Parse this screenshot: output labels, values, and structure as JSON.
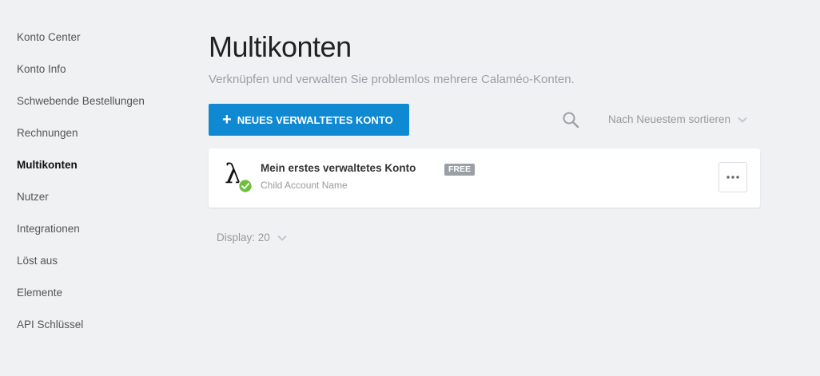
{
  "sidebar": {
    "items": [
      {
        "label": "Konto Center"
      },
      {
        "label": "Konto Info"
      },
      {
        "label": "Schwebende Bestellungen"
      },
      {
        "label": "Rechnungen"
      },
      {
        "label": "Multikonten",
        "active": true
      },
      {
        "label": "Nutzer"
      },
      {
        "label": "Integrationen"
      },
      {
        "label": "Löst aus"
      },
      {
        "label": "Elemente"
      },
      {
        "label": "API Schlüssel"
      }
    ]
  },
  "header": {
    "title": "Multikonten",
    "subtitle": "Verknüpfen und verwalten Sie problemlos mehrere Calaméo-Konten."
  },
  "toolbar": {
    "new_button_label": "NEUES VERWALTETES KONTO",
    "sort_label": "Nach Neuestem sortieren"
  },
  "accounts": [
    {
      "name": "Mein erstes verwaltetes Konto",
      "subtitle": "Child Account Name",
      "plan": "FREE"
    }
  ],
  "pagination": {
    "display_label": "Display: 20"
  },
  "colors": {
    "accent": "#0f89d2",
    "status_ok": "#6dbf3b",
    "badge_gray": "#9aa0a6"
  }
}
